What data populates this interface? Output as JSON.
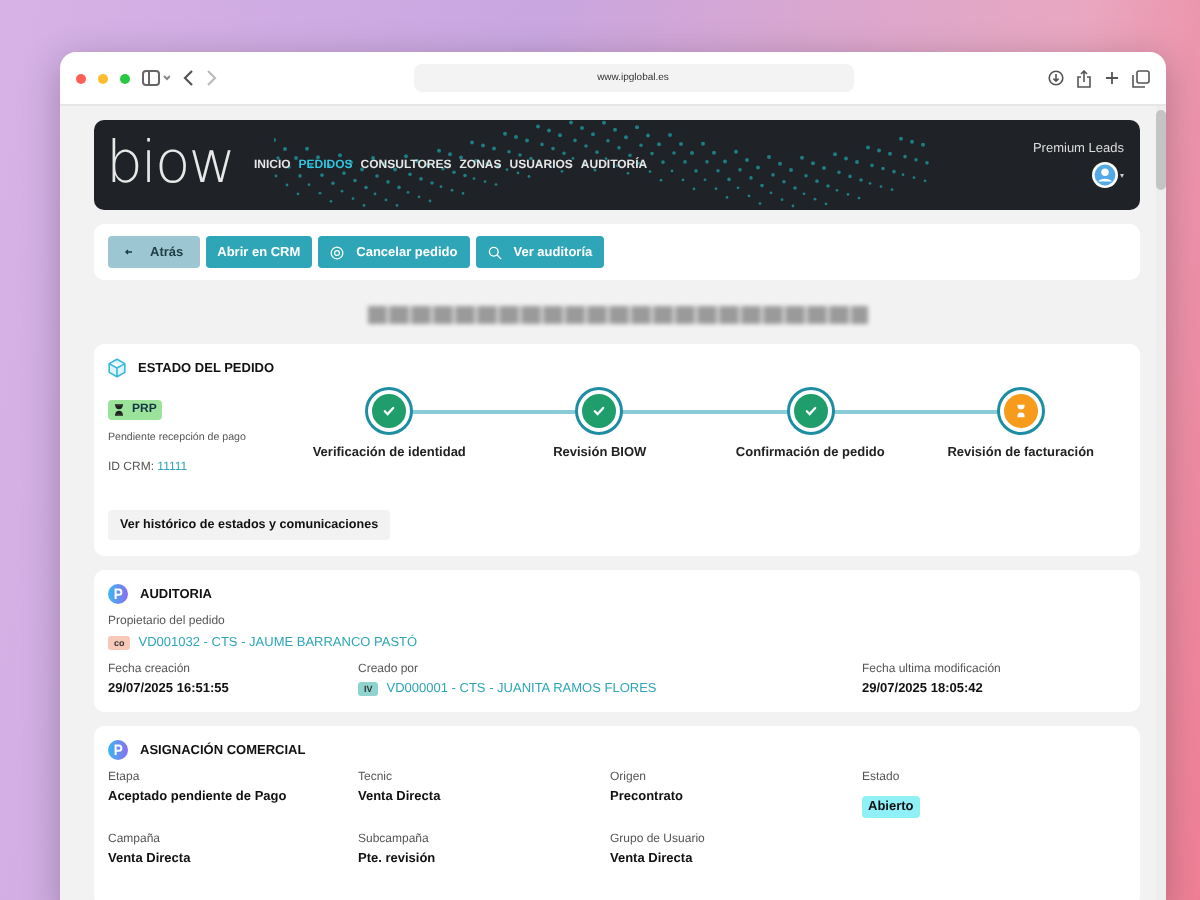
{
  "browser": {
    "url": "www.ipglobal.es"
  },
  "header": {
    "logo": "biow",
    "account": "Premium Leads",
    "nav": [
      {
        "label": "INICIO",
        "selected": false
      },
      {
        "label": "PEDIDOS",
        "selected": true
      },
      {
        "label": "CONSULTORES",
        "selected": false
      },
      {
        "label": "ZONAS",
        "selected": false
      },
      {
        "label": "USUARIOS",
        "selected": false
      },
      {
        "label": "AUDITORÍA",
        "selected": false
      }
    ]
  },
  "actions": [
    {
      "label": "Atrás",
      "kind": "back"
    },
    {
      "label": "Abrir en CRM",
      "kind": "plain"
    },
    {
      "label": "Cancelar pedido",
      "kind": "cancel"
    },
    {
      "label": "Ver auditoría",
      "kind": "search"
    }
  ],
  "status": {
    "title": "ESTADO DEL PEDIDO",
    "badge": "PRP",
    "badge_caption": "Pendiente recepción de pago",
    "crm_label": "ID CRM:",
    "crm_id": "11111",
    "steps": [
      {
        "label": "Verificación de identidad",
        "completed": true
      },
      {
        "label": "Revisión BIOW",
        "completed": true
      },
      {
        "label": "Confirmación de pedido",
        "completed": true
      },
      {
        "label": "Revisión de facturación",
        "completed": false
      }
    ],
    "history_button": "Ver histórico de estados y comunicaciones"
  },
  "audit": {
    "title": "AUDITORIA",
    "owner_label": "Propietario del pedido",
    "owner": {
      "tag": "co",
      "color": "#f8c9b8",
      "text": "VD001032 - CTS - JAUME BARRANCO PASTÓ"
    },
    "fields": [
      {
        "label": "Fecha creación",
        "value": "29/07/2025 16:51:55",
        "kind": "text"
      },
      {
        "label": "Creado por",
        "value": "VD000001 - CTS - JUANITA RAMOS FLORES",
        "kind": "user",
        "tag": "IV",
        "color": "#8fd3cf"
      },
      {
        "label": "Fecha ultima modificación",
        "value": "29/07/2025 18:05:42",
        "kind": "text"
      }
    ]
  },
  "assignment": {
    "title": "ASIGNACIÓN COMERCIAL",
    "fields": [
      {
        "label": "Etapa",
        "value": "Aceptado pendiente de Pago",
        "kind": "text"
      },
      {
        "label": "Tecnic",
        "value": "Venta Directa",
        "kind": "text"
      },
      {
        "label": "Origen",
        "value": "Precontrato",
        "kind": "text"
      },
      {
        "label": "Estado",
        "value": "Abierto",
        "kind": "status"
      },
      {
        "label": "Campaña",
        "value": "Venta Directa",
        "kind": "text"
      },
      {
        "label": "Subcampaña",
        "value": "Pte. revisión",
        "kind": "text"
      },
      {
        "label": "Grupo de Usuario",
        "value": "Venta Directa",
        "kind": "text"
      }
    ]
  }
}
